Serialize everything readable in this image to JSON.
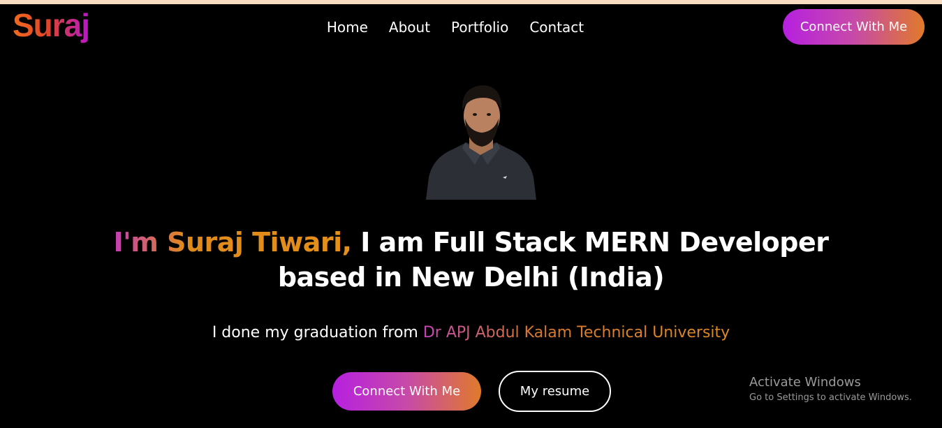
{
  "header": {
    "logo_text": "Suraj",
    "nav": [
      {
        "label": "Home"
      },
      {
        "label": "About"
      },
      {
        "label": "Portfolio"
      },
      {
        "label": "Contact"
      }
    ],
    "connect_label": "Connect With Me"
  },
  "hero": {
    "headline_prefix": "I'm Suraj Tiwari,",
    "headline_rest": " I am Full Stack MERN Developer",
    "headline_line2": "based in New Delhi (India)",
    "sub_prefix": "I done my graduation from ",
    "sub_university": "Dr APJ Abdul Kalam Technical University",
    "cta_label": "Connect With Me",
    "resume_label": "My resume"
  },
  "watermark": {
    "title": "Activate Windows",
    "subtitle": "Go to Settings to activate Windows."
  },
  "colors": {
    "background": "#000000",
    "top_strip": "#f7dcc1",
    "gradient_start": "#b620e0",
    "gradient_end": "#e07a2a",
    "text": "#ffffff"
  }
}
